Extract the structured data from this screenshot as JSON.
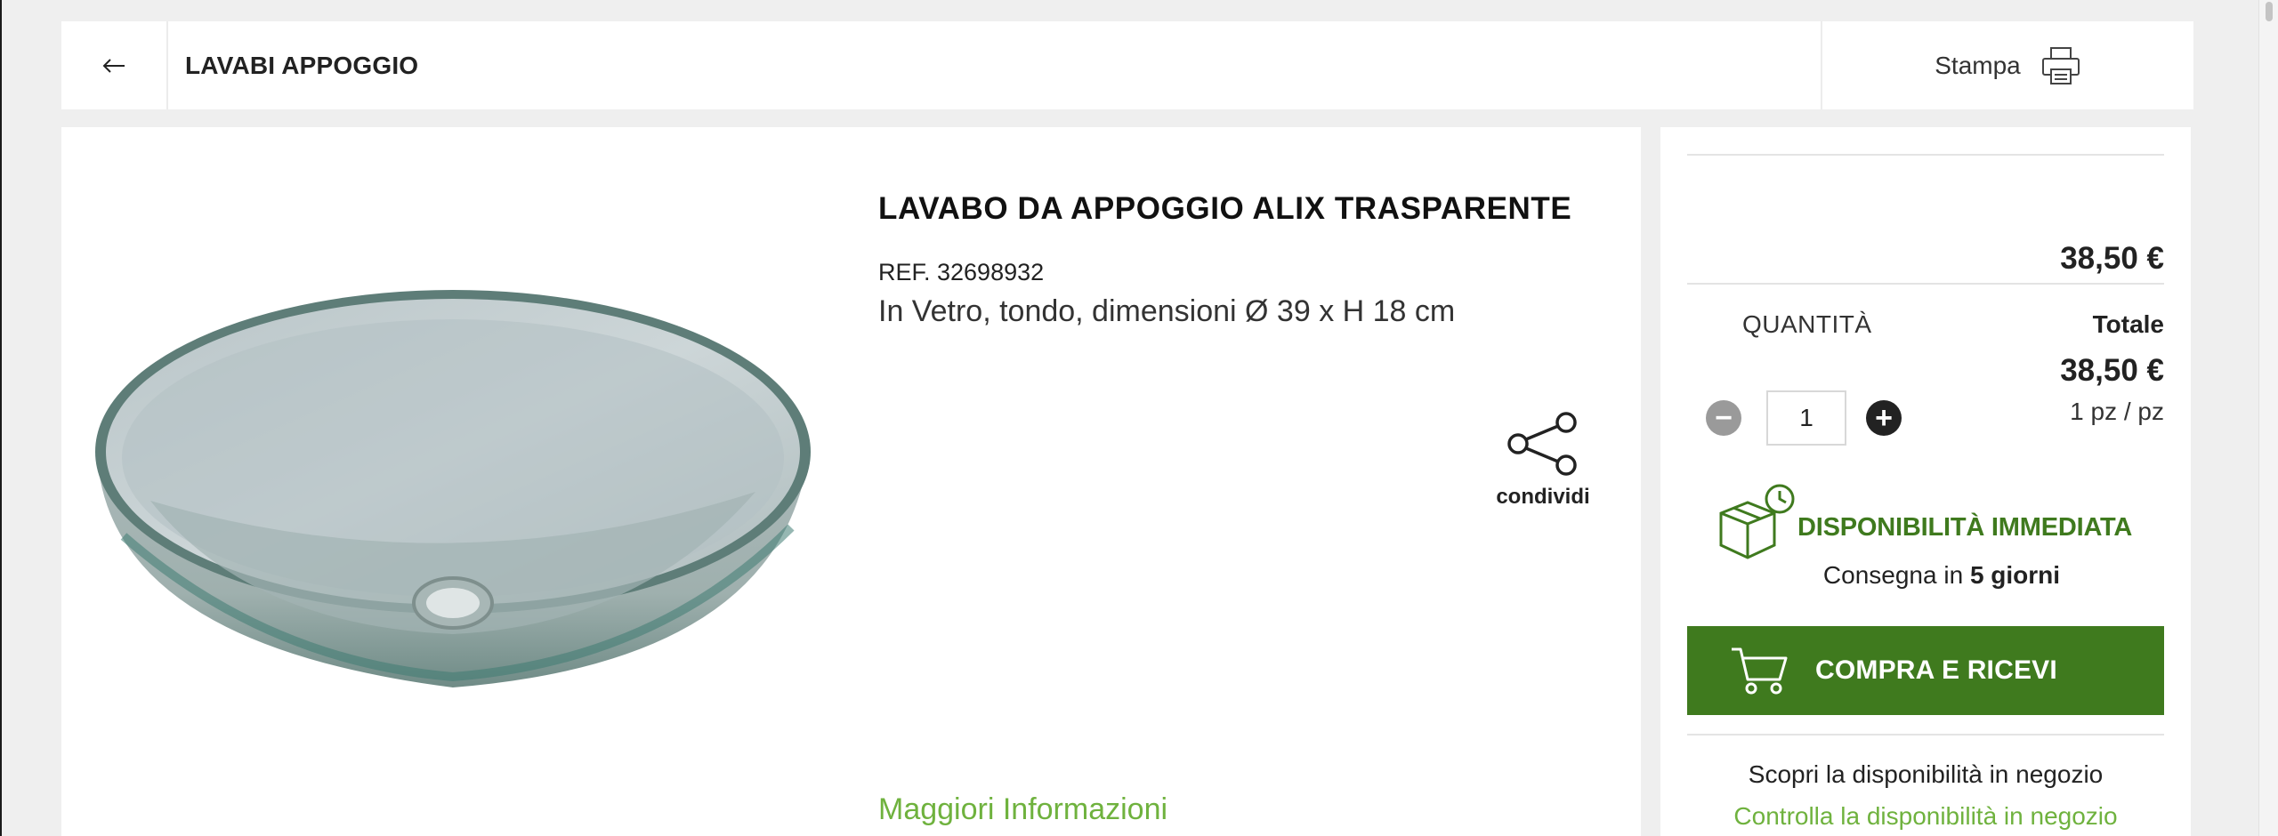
{
  "header": {
    "title": "LAVABI APPOGGIO",
    "print_label": "Stampa"
  },
  "product": {
    "title": "LAVABO DA APPOGGIO ALIX TRASPARENTE",
    "ref": "REF. 32698932",
    "description": "In Vetro, tondo, dimensioni Ø 39 x H 18 cm",
    "share_label": "condividi",
    "more_info_label": "Maggiori Informazioni"
  },
  "purchase": {
    "unit_price": "38,50 €",
    "quantity_label": "QUANTITÀ",
    "total_label": "Totale",
    "total_price": "38,50 €",
    "per_unit": "1 pz / pz",
    "quantity_value": "1",
    "minus_symbol": "−",
    "plus_symbol": "+",
    "availability_label": "DISPONIBILITÀ IMMEDIATA",
    "delivery_prefix": "Consegna in",
    "delivery_days": "5 giorni",
    "buy_label": "COMPRA E RICEVI",
    "store_text": "Scopri la disponibilità in negozio",
    "store_link": "Controlla la disponibilità in negozio"
  },
  "colors": {
    "brand_green": "#3f7a1e",
    "link_green": "#6fb23e",
    "background": "#efefef"
  },
  "icons": {
    "back": "arrow-left-icon",
    "print": "printer-icon",
    "share": "share-icon",
    "availability": "box-clock-icon",
    "cart": "cart-icon"
  }
}
